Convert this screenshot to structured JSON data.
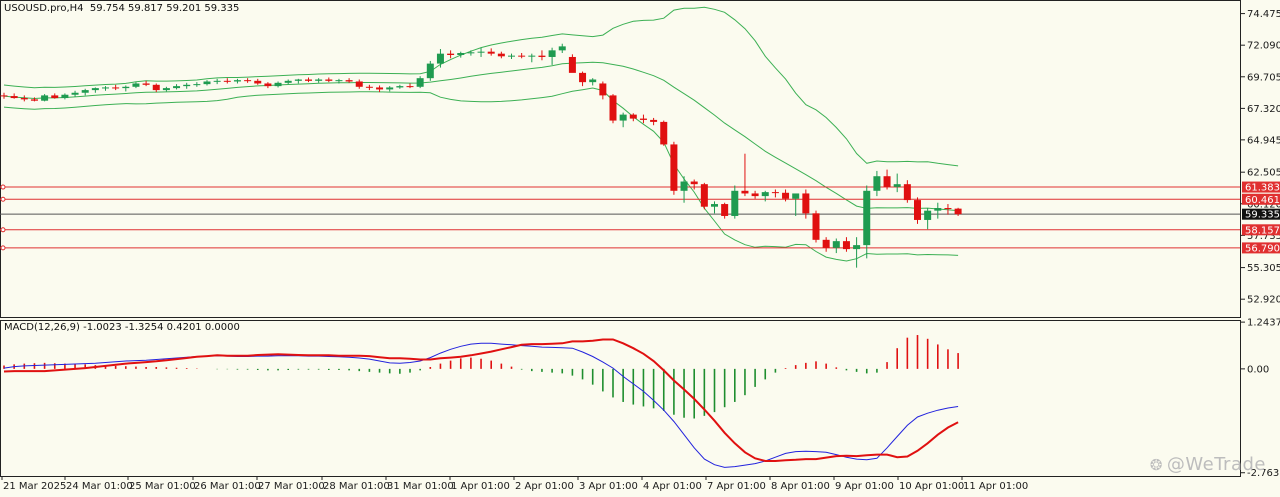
{
  "header": {
    "symbol_tf": "USOUSD.pro,H4",
    "ohlc": "59.754 59.817 59.201 59.335"
  },
  "macd_header": "MACD(12,26,9) -1.0023 -1.3254 0.4201 0.0000",
  "watermark": "@WeTrade",
  "chart_data": [
    {
      "type": "candlestick",
      "ylim": [
        51.5,
        75.5
      ],
      "price_ticks": [
        "74.475",
        "72.090",
        "69.705",
        "67.320",
        "64.945",
        "62.505",
        "60.120",
        "57.735",
        "55.305",
        "52.920"
      ],
      "x_labels": [
        "21 Mar 2025",
        "24 Mar 01:00",
        "25 Mar 01:00",
        "26 Mar 01:00",
        "27 Mar 01:00",
        "28 Mar 01:00",
        "31 Mar 01:00",
        "1 Apr 01:00",
        "2 Apr 01:00",
        "3 Apr 01:00",
        "4 Apr 01:00",
        "7 Apr 01:00",
        "8 Apr 01:00",
        "9 Apr 01:00",
        "10 Apr 01:00",
        "11 Apr 01:00"
      ],
      "current_price": "59.335",
      "levels": [
        {
          "value": 61.383,
          "label": "61.383",
          "color": "#e03030"
        },
        {
          "value": 60.461,
          "label": "60.461",
          "color": "#e03030"
        },
        {
          "value": 58.157,
          "label": "58.157",
          "color": "#e03030"
        },
        {
          "value": 56.79,
          "label": "56.790",
          "color": "#e03030"
        }
      ],
      "colors": {
        "bull": "#1f9b50",
        "bear": "#e01010",
        "band": "#3cb054"
      },
      "candles": [
        [
          68.3,
          68.5,
          68.05,
          68.25
        ],
        [
          68.25,
          68.45,
          68.05,
          68.1
        ],
        [
          68.1,
          68.3,
          67.85,
          68.0
        ],
        [
          68.0,
          68.15,
          67.85,
          67.9
        ],
        [
          67.9,
          68.4,
          67.85,
          68.3
        ],
        [
          68.3,
          68.45,
          68.05,
          68.1
        ],
        [
          68.1,
          68.45,
          68.0,
          68.35
        ],
        [
          68.35,
          68.65,
          68.2,
          68.5
        ],
        [
          68.5,
          68.8,
          68.3,
          68.7
        ],
        [
          68.7,
          68.9,
          68.5,
          68.85
        ],
        [
          68.85,
          69.0,
          68.65,
          68.9
        ],
        [
          68.9,
          69.1,
          68.7,
          68.85
        ],
        [
          68.85,
          69.05,
          68.6,
          68.95
        ],
        [
          68.95,
          69.3,
          68.85,
          69.2
        ],
        [
          69.2,
          69.4,
          69.0,
          69.1
        ],
        [
          69.1,
          69.2,
          68.55,
          68.7
        ],
        [
          68.7,
          68.95,
          68.6,
          68.85
        ],
        [
          68.85,
          69.15,
          68.75,
          69.0
        ],
        [
          69.0,
          69.25,
          68.8,
          69.1
        ],
        [
          69.1,
          69.3,
          68.95,
          69.15
        ],
        [
          69.15,
          69.45,
          69.05,
          69.35
        ],
        [
          69.35,
          69.55,
          69.15,
          69.4
        ],
        [
          69.4,
          69.6,
          69.2,
          69.35
        ],
        [
          69.35,
          69.55,
          69.2,
          69.45
        ],
        [
          69.45,
          69.6,
          69.25,
          69.4
        ],
        [
          69.4,
          69.55,
          69.1,
          69.2
        ],
        [
          69.2,
          69.3,
          68.85,
          69.0
        ],
        [
          69.0,
          69.35,
          68.9,
          69.25
        ],
        [
          69.25,
          69.5,
          69.15,
          69.4
        ],
        [
          69.4,
          69.55,
          69.2,
          69.5
        ],
        [
          69.5,
          69.65,
          69.3,
          69.4
        ],
        [
          69.4,
          69.6,
          69.25,
          69.5
        ],
        [
          69.5,
          69.65,
          69.3,
          69.4
        ],
        [
          69.4,
          69.55,
          69.2,
          69.45
        ],
        [
          69.45,
          69.6,
          69.25,
          69.35
        ],
        [
          69.35,
          69.5,
          68.8,
          68.95
        ],
        [
          68.95,
          69.1,
          68.7,
          68.9
        ],
        [
          68.9,
          69.05,
          68.55,
          68.75
        ],
        [
          68.75,
          69.0,
          68.6,
          68.9
        ],
        [
          68.9,
          69.1,
          68.8,
          69.0
        ],
        [
          69.0,
          69.2,
          68.85,
          68.95
        ],
        [
          68.95,
          69.75,
          68.85,
          69.6
        ],
        [
          69.6,
          70.9,
          69.4,
          70.7
        ],
        [
          70.7,
          71.8,
          70.4,
          71.45
        ],
        [
          71.45,
          71.7,
          71.1,
          71.35
        ],
        [
          71.35,
          71.6,
          71.15,
          71.5
        ],
        [
          71.5,
          71.7,
          71.3,
          71.55
        ],
        [
          71.55,
          71.9,
          71.2,
          71.6
        ],
        [
          71.6,
          71.85,
          71.3,
          71.45
        ],
        [
          71.45,
          71.6,
          71.1,
          71.25
        ],
        [
          71.25,
          71.45,
          71.05,
          71.3
        ],
        [
          71.3,
          71.5,
          71.1,
          71.25
        ],
        [
          71.25,
          71.45,
          70.8,
          71.3
        ],
        [
          71.3,
          71.7,
          70.95,
          71.2
        ],
        [
          71.2,
          71.9,
          70.6,
          71.7
        ],
        [
          71.7,
          72.2,
          71.5,
          72.0
        ],
        [
          71.2,
          71.4,
          70.2,
          70.0
        ],
        [
          70.0,
          70.1,
          69.0,
          69.3
        ],
        [
          69.3,
          69.6,
          69.05,
          69.5
        ],
        [
          69.2,
          69.35,
          68.0,
          68.3
        ],
        [
          68.3,
          68.4,
          66.2,
          66.4
        ],
        [
          66.4,
          67.0,
          65.9,
          66.85
        ],
        [
          66.85,
          66.95,
          66.35,
          66.55
        ],
        [
          66.55,
          66.85,
          66.2,
          66.45
        ],
        [
          66.45,
          66.6,
          66.05,
          66.3
        ],
        [
          66.3,
          66.4,
          64.5,
          64.6
        ],
        [
          64.6,
          64.8,
          60.8,
          61.1
        ],
        [
          61.1,
          62.2,
          60.2,
          61.8
        ],
        [
          61.8,
          61.95,
          61.2,
          61.6
        ],
        [
          61.6,
          61.7,
          59.7,
          59.9
        ],
        [
          59.9,
          60.3,
          59.4,
          60.1
        ],
        [
          60.1,
          60.2,
          59.0,
          59.2
        ],
        [
          59.2,
          61.5,
          59.0,
          61.1
        ],
        [
          61.1,
          63.9,
          60.7,
          60.9
        ],
        [
          60.9,
          61.1,
          60.5,
          60.7
        ],
        [
          60.7,
          61.1,
          60.3,
          61.0
        ],
        [
          61.0,
          61.2,
          60.6,
          60.95
        ],
        [
          60.95,
          61.2,
          60.3,
          60.5
        ],
        [
          60.5,
          60.8,
          59.2,
          60.9
        ],
        [
          60.9,
          61.2,
          59.0,
          59.4
        ],
        [
          59.4,
          59.6,
          57.2,
          57.4
        ],
        [
          57.4,
          57.6,
          56.5,
          56.8
        ],
        [
          56.8,
          57.5,
          56.4,
          57.3
        ],
        [
          57.3,
          57.6,
          56.5,
          56.7
        ],
        [
          56.7,
          57.6,
          55.3,
          57.0
        ],
        [
          57.0,
          61.5,
          56.0,
          61.1
        ],
        [
          61.1,
          62.6,
          60.7,
          62.2
        ],
        [
          62.2,
          62.7,
          61.2,
          61.4
        ],
        [
          61.4,
          62.4,
          61.0,
          61.6
        ],
        [
          61.6,
          61.9,
          60.2,
          60.4
        ],
        [
          60.4,
          60.6,
          58.6,
          58.9
        ],
        [
          58.9,
          59.8,
          58.2,
          59.6
        ],
        [
          59.6,
          60.2,
          59.0,
          59.8
        ],
        [
          59.8,
          60.1,
          59.3,
          59.75
        ],
        [
          59.754,
          59.817,
          59.201,
          59.335
        ]
      ]
    },
    {
      "type": "macd",
      "ylim": [
        -2.85,
        1.3
      ],
      "ticks": [
        "1.2437",
        "0.00",
        "-2.7631"
      ],
      "params": "MACD(12,26,9)",
      "colors": {
        "hist_pos": "#e01010",
        "hist_neg": "#1e8e2e",
        "macd_line": "#2222dd",
        "signal_line": "#e01010"
      },
      "hist": [
        0.09,
        0.12,
        0.14,
        0.15,
        0.16,
        0.15,
        0.14,
        0.13,
        0.12,
        0.1,
        0.09,
        0.08,
        0.07,
        0.06,
        0.05,
        0.05,
        0.04,
        0.03,
        0.02,
        0.01,
        0.0,
        -0.01,
        -0.01,
        -0.02,
        -0.02,
        -0.03,
        -0.04,
        -0.04,
        -0.03,
        -0.02,
        -0.02,
        -0.02,
        -0.03,
        -0.03,
        -0.04,
        -0.06,
        -0.08,
        -0.1,
        -0.12,
        -0.13,
        -0.1,
        -0.04,
        0.05,
        0.14,
        0.22,
        0.28,
        0.3,
        0.27,
        0.22,
        0.14,
        0.06,
        -0.02,
        -0.06,
        -0.08,
        -0.1,
        -0.12,
        -0.18,
        -0.28,
        -0.42,
        -0.6,
        -0.76,
        -0.88,
        -0.95,
        -1.0,
        -1.05,
        -1.12,
        -1.22,
        -1.3,
        -1.32,
        -1.25,
        -1.15,
        -1.02,
        -0.88,
        -0.7,
        -0.48,
        -0.28,
        -0.1,
        0.02,
        0.1,
        0.16,
        0.2,
        0.14,
        0.04,
        -0.04,
        -0.08,
        -0.12,
        -0.1,
        0.18,
        0.55,
        0.83,
        0.9,
        0.8,
        0.65,
        0.52,
        0.42
      ],
      "macd_line": [
        0.02,
        0.06,
        0.08,
        0.09,
        0.1,
        0.11,
        0.12,
        0.13,
        0.14,
        0.15,
        0.17,
        0.19,
        0.21,
        0.22,
        0.23,
        0.25,
        0.27,
        0.29,
        0.31,
        0.33,
        0.34,
        0.35,
        0.34,
        0.33,
        0.33,
        0.34,
        0.34,
        0.35,
        0.35,
        0.35,
        0.34,
        0.34,
        0.33,
        0.32,
        0.31,
        0.29,
        0.26,
        0.21,
        0.16,
        0.15,
        0.17,
        0.21,
        0.3,
        0.42,
        0.52,
        0.6,
        0.66,
        0.68,
        0.68,
        0.66,
        0.64,
        0.62,
        0.6,
        0.58,
        0.57,
        0.56,
        0.55,
        0.45,
        0.33,
        0.18,
        0.02,
        -0.2,
        -0.4,
        -0.6,
        -0.84,
        -1.1,
        -1.4,
        -1.75,
        -2.1,
        -2.4,
        -2.55,
        -2.62,
        -2.6,
        -2.56,
        -2.52,
        -2.45,
        -2.35,
        -2.25,
        -2.2,
        -2.19,
        -2.2,
        -2.22,
        -2.28,
        -2.35,
        -2.4,
        -2.42,
        -2.38,
        -2.1,
        -1.8,
        -1.5,
        -1.28,
        -1.18,
        -1.1,
        -1.04,
        -1.0
      ],
      "signal_line": [
        -0.07,
        -0.06,
        -0.06,
        -0.06,
        -0.06,
        -0.04,
        -0.02,
        0.0,
        0.02,
        0.05,
        0.08,
        0.11,
        0.14,
        0.16,
        0.18,
        0.2,
        0.23,
        0.26,
        0.29,
        0.32,
        0.34,
        0.36,
        0.35,
        0.35,
        0.35,
        0.37,
        0.38,
        0.39,
        0.38,
        0.37,
        0.36,
        0.36,
        0.36,
        0.35,
        0.35,
        0.35,
        0.34,
        0.31,
        0.28,
        0.28,
        0.27,
        0.25,
        0.25,
        0.28,
        0.3,
        0.32,
        0.36,
        0.41,
        0.46,
        0.52,
        0.58,
        0.64,
        0.66,
        0.66,
        0.67,
        0.68,
        0.73,
        0.73,
        0.75,
        0.78,
        0.78,
        0.68,
        0.55,
        0.4,
        0.21,
        -0.04,
        -0.31,
        -0.55,
        -0.8,
        -1.08,
        -1.38,
        -1.7,
        -1.98,
        -2.22,
        -2.38,
        -2.45,
        -2.45,
        -2.43,
        -2.42,
        -2.4,
        -2.4,
        -2.36,
        -2.32,
        -2.31,
        -2.32,
        -2.3,
        -2.28,
        -2.28,
        -2.35,
        -2.33,
        -2.18,
        -1.98,
        -1.75,
        -1.56,
        -1.42
      ]
    }
  ]
}
